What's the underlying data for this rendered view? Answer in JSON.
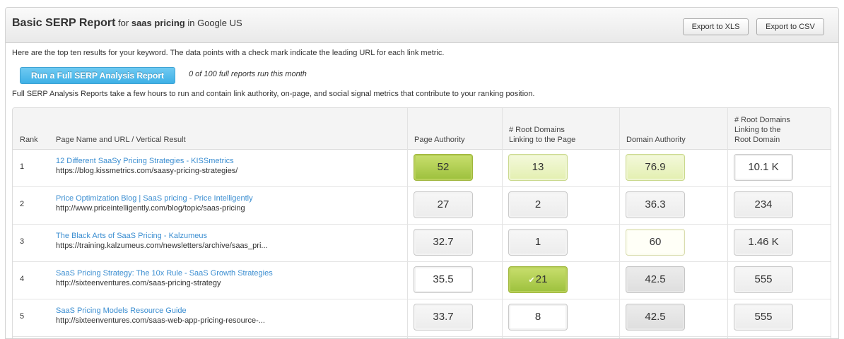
{
  "header": {
    "title": "Basic SERP Report",
    "for_word": "for",
    "keyword": "saas pricing",
    "in_word": "in",
    "engine": "Google US",
    "export_xls": "Export to XLS",
    "export_csv": "Export to CSV"
  },
  "intro_text": "Here are the top ten results for your keyword. The data points with a check mark indicate the leading URL for each link metric.",
  "run_button": "Run a Full SERP Analysis Report",
  "runs_status": "0 of 100 full reports run this month",
  "full_desc": "Full SERP Analysis Reports take a few hours to run and contain link authority, on-page, and social signal metrics that contribute to your ranking position.",
  "columns": {
    "rank": "Rank",
    "page": "Page Name and URL / Vertical Result",
    "pa": "Page Authority",
    "rd_page_1": "# Root Domains",
    "rd_page_2": "Linking to the Page",
    "da": "Domain Authority",
    "rd_root_1": "# Root Domains",
    "rd_root_2": "Linking to the",
    "rd_root_3": "Root Domain"
  },
  "rows": [
    {
      "rank": "1",
      "title": "12 Different SaaSy Pricing Strategies - KISSmetrics",
      "url": "https://blog.kissmetrics.com/saasy-pricing-strategies/",
      "pa": "52",
      "rd_page": "13",
      "da": "76.9",
      "rd_root": "10.1 K"
    },
    {
      "rank": "2",
      "title": "Price Optimization Blog | SaaS pricing - Price Intelligently",
      "url": "http://www.priceintelligently.com/blog/topic/saas-pricing",
      "pa": "27",
      "rd_page": "2",
      "da": "36.3",
      "rd_root": "234"
    },
    {
      "rank": "3",
      "title": "The Black Arts of SaaS Pricing - Kalzumeus",
      "url": "https://training.kalzumeus.com/newsletters/archive/saas_pri...",
      "pa": "32.7",
      "rd_page": "1",
      "da": "60",
      "rd_root": "1.46 K"
    },
    {
      "rank": "4",
      "title": "SaaS Pricing Strategy: The 10x Rule - SaaS Growth Strategies",
      "url": "http://sixteenventures.com/saas-pricing-strategy",
      "pa": "35.5",
      "rd_page": "21",
      "da": "42.5",
      "rd_root": "555"
    },
    {
      "rank": "5",
      "title": "SaaS Pricing Models Resource Guide",
      "url": "http://sixteenventures.com/saas-web-app-pricing-resource-...",
      "pa": "33.7",
      "rd_page": "8",
      "da": "42.5",
      "rd_root": "555"
    }
  ],
  "icons": {
    "check": "check-icon"
  },
  "colors": {
    "link": "#3b8ed1",
    "lead_green": "#9cc03c",
    "run_button": "#3eb0e6"
  }
}
